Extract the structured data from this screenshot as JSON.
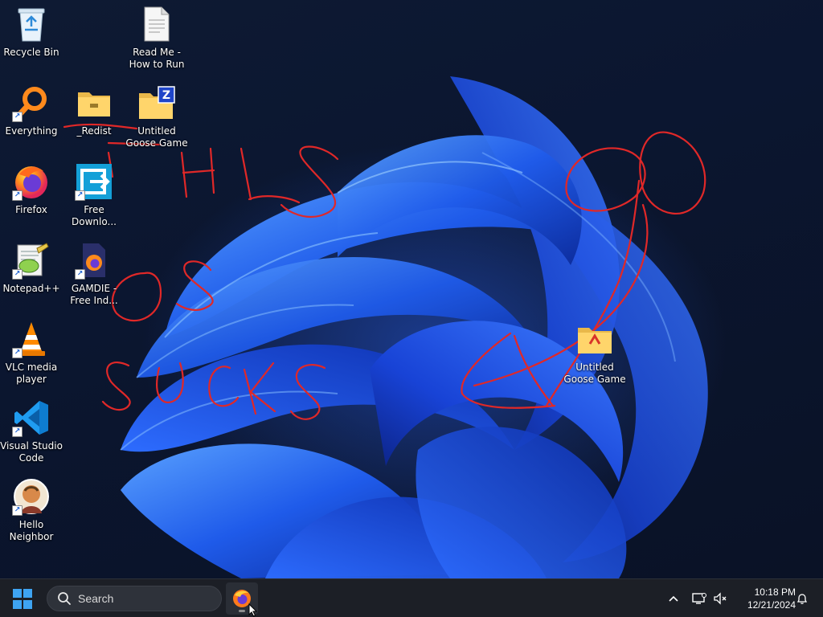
{
  "desktop": {
    "icons": [
      {
        "id": "recycle-bin",
        "label": "Recycle Bin",
        "shortcut": false
      },
      {
        "id": "read-me",
        "label": "Read Me - How to Run",
        "shortcut": false
      },
      {
        "id": "everything",
        "label": "Everything",
        "shortcut": true
      },
      {
        "id": "redist",
        "label": "_Redist",
        "shortcut": false
      },
      {
        "id": "untitled-goose-game-1",
        "label": "Untitled Goose Game",
        "shortcut": false
      },
      {
        "id": "firefox",
        "label": "Firefox",
        "shortcut": true
      },
      {
        "id": "free-download-manager",
        "label": "Free Downlo...",
        "shortcut": true
      },
      {
        "id": "notepad-plus-plus",
        "label": "Notepad++",
        "shortcut": true
      },
      {
        "id": "gamdie",
        "label": "GAMDIE - Free Ind...",
        "shortcut": true
      },
      {
        "id": "vlc",
        "label": "VLC media player",
        "shortcut": true
      },
      {
        "id": "vscode",
        "label": "Visual Studio Code",
        "shortcut": true
      },
      {
        "id": "hello-neighbor",
        "label": "Hello Neighbor",
        "shortcut": true
      },
      {
        "id": "untitled-goose-game-2",
        "label": "Untitled Goose Game",
        "shortcut": false
      }
    ]
  },
  "taskbar": {
    "search_label": "Search",
    "pinned": [
      {
        "id": "firefox",
        "icon": "firefox-icon",
        "running": true
      }
    ],
    "tray_icons": [
      "chevron-up-icon",
      "network-icon",
      "volume-icon",
      "notification-bell-icon"
    ],
    "clock_time": "10:18 PM",
    "clock_date": "12/21/2024"
  },
  "colors": {
    "accent": "#3ea4f2",
    "scribble": "#e02828",
    "taskbar": "#1c1f26",
    "wallpaper_bloom": "#1f5bea"
  }
}
